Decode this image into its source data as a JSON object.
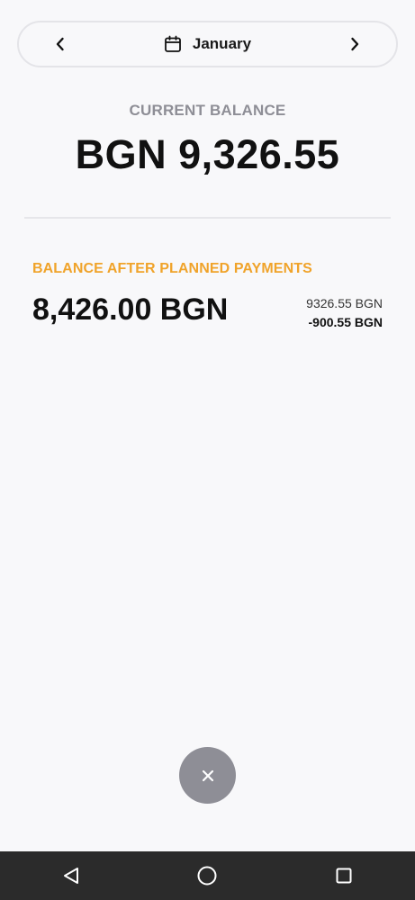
{
  "month_selector": {
    "month": "January",
    "prev_icon": "chevron-left-icon",
    "next_icon": "chevron-right-icon",
    "calendar_icon": "calendar-icon"
  },
  "current_balance": {
    "label": "CURRENT BALANCE",
    "value": "BGN 9,326.55"
  },
  "planned": {
    "label": "BALANCE AFTER PLANNED PAYMENTS",
    "value": "8,426.00 BGN",
    "current_amount": "9326.55 BGN",
    "planned_payments": "-900.55 BGN",
    "label_color": "#f0a32a"
  },
  "fab": {
    "icon": "close-icon",
    "color": "#8e8e96"
  },
  "system_nav": {
    "back_icon": "back-triangle-icon",
    "home_icon": "home-circle-icon",
    "recent_icon": "recents-square-icon"
  }
}
